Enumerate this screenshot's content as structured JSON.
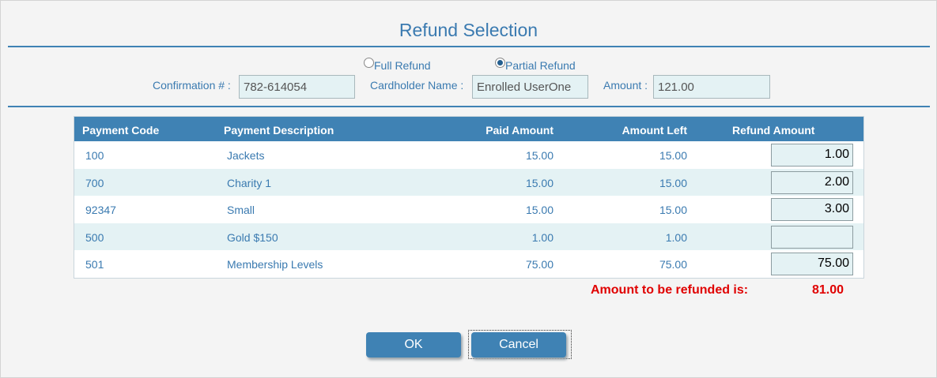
{
  "dialog": {
    "title": "Refund Selection"
  },
  "refund_type": {
    "full_label": "Full Refund",
    "partial_label": "Partial Refund",
    "selected": "partial"
  },
  "fields": {
    "confirmation_label": "Confirmation # :",
    "confirmation_value": "782-614054",
    "cardholder_label": "Cardholder Name :",
    "cardholder_value": "Enrolled UserOne",
    "amount_label": "Amount :",
    "amount_value": "121.00"
  },
  "table": {
    "headers": {
      "code": "Payment Code",
      "description": "Payment Description",
      "paid": "Paid Amount",
      "left": "Amount Left",
      "refund": "Refund Amount"
    },
    "rows": [
      {
        "code": "100",
        "description": "Jackets",
        "paid": "15.00",
        "left": "15.00",
        "refund": "1.00"
      },
      {
        "code": "700",
        "description": "Charity 1",
        "paid": "15.00",
        "left": "15.00",
        "refund": "2.00"
      },
      {
        "code": "92347",
        "description": "Small",
        "paid": "15.00",
        "left": "15.00",
        "refund": "3.00"
      },
      {
        "code": "500",
        "description": "Gold $150",
        "paid": "1.00",
        "left": "1.00",
        "refund": ""
      },
      {
        "code": "501",
        "description": "Membership Levels",
        "paid": "75.00",
        "left": "75.00",
        "refund": "75.00"
      }
    ]
  },
  "total": {
    "label": "Amount to be refunded is:",
    "value": "81.00"
  },
  "buttons": {
    "ok": "OK",
    "cancel": "Cancel"
  },
  "colors": {
    "accent": "#3f82b4",
    "text": "#3a7ab0",
    "alert": "#e00000",
    "field_bg": "#e4f2f4"
  }
}
